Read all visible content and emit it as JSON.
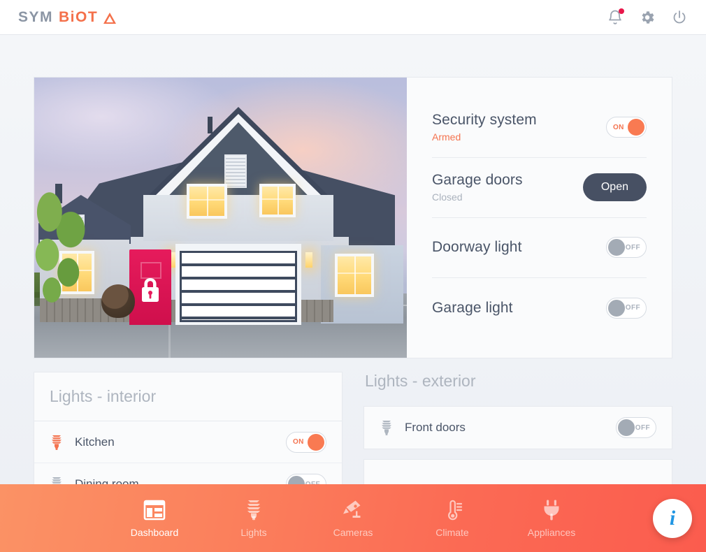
{
  "header": {
    "logo": {
      "part1": "SYM",
      "part2": "BiOT",
      "triangle_icon": "triangle-icon"
    },
    "icons": [
      {
        "name": "notifications-bell-icon",
        "label": "Notifications",
        "has_badge": true
      },
      {
        "name": "settings-gear-icon",
        "label": "Settings",
        "has_badge": false
      },
      {
        "name": "power-icon",
        "label": "Power",
        "has_badge": false
      }
    ],
    "accent_color": "#f4704a",
    "logo_gray": "#8b95a4",
    "badge_color": "#e8174a"
  },
  "hero": {
    "photo_alt": "house-exterior-photo",
    "lock_icon": "lock-icon",
    "rows": [
      {
        "title": "Security system",
        "status": "Armed",
        "status_kind": "armed",
        "control": "toggle",
        "toggle_state": "ON"
      },
      {
        "title": "Garage doors",
        "status": "Closed",
        "status_kind": "muted",
        "control": "button",
        "button_label": "Open"
      },
      {
        "title": "Doorway light",
        "status": "",
        "status_kind": "none",
        "control": "toggle",
        "toggle_state": "OFF"
      },
      {
        "title": "Garage light",
        "status": "",
        "status_kind": "none",
        "control": "toggle",
        "toggle_state": "OFF"
      }
    ]
  },
  "lights_interior": {
    "title": "Lights - interior",
    "devices": [
      {
        "name": "Kitchen",
        "icon": "light-bulb-icon",
        "toggle_state": "ON"
      },
      {
        "name": "Dining room",
        "icon": "light-bulb-icon",
        "toggle_state": "OFF"
      }
    ]
  },
  "lights_exterior": {
    "title": "Lights - exterior",
    "devices": [
      {
        "name": "Front doors",
        "icon": "light-bulb-icon",
        "toggle_state": "OFF"
      }
    ]
  },
  "bottom_nav": {
    "items": [
      {
        "label": "Dashboard",
        "icon": "dashboard-icon",
        "active": true
      },
      {
        "label": "Lights",
        "icon": "light-bulb-icon",
        "active": false
      },
      {
        "label": "Cameras",
        "icon": "camera-icon",
        "active": false
      },
      {
        "label": "Climate",
        "icon": "thermometer-icon",
        "active": false
      },
      {
        "label": "Appliances",
        "icon": "plug-icon",
        "active": false
      }
    ],
    "gradient_from": "#fb9265",
    "gradient_to": "#fb5c4e"
  },
  "fab": {
    "label": "i",
    "name": "info-button",
    "color": "#2196e3"
  }
}
